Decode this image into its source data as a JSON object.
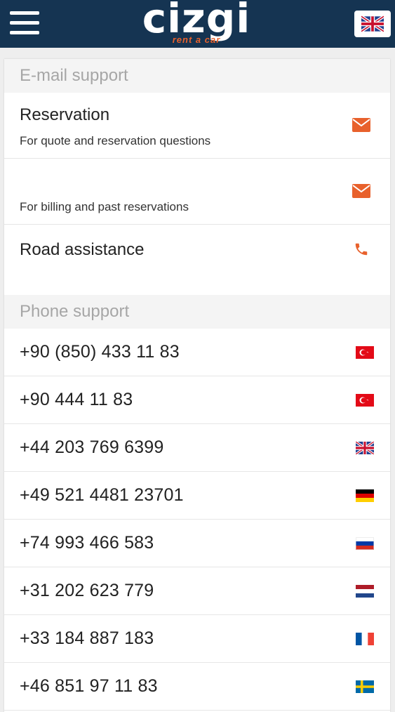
{
  "header": {
    "logo_main": "cizgi",
    "logo_sub": "rent a car",
    "language_flag_icon": "uk-flag-icon",
    "background": "#153452"
  },
  "accent_color": "#e8612c",
  "email_support": {
    "heading": "E-mail support",
    "items": [
      {
        "title": "Reservation",
        "description": "For quote and reservation questions",
        "icon": "envelope-icon"
      },
      {
        "title": "",
        "description": "For billing and past reservations",
        "icon": "envelope-icon"
      }
    ]
  },
  "road_assistance": {
    "title": "Road assistance",
    "icon": "phone-icon"
  },
  "phone_support": {
    "heading": "Phone support",
    "numbers": [
      {
        "number": "+90 (850) 433 11 83",
        "flag": "turkey-flag-icon"
      },
      {
        "number": "+90 444 11 83",
        "flag": "turkey-flag-icon"
      },
      {
        "number": "+44 203 769 6399",
        "flag": "uk-flag-icon"
      },
      {
        "number": "+49 521 4481 23701",
        "flag": "germany-flag-icon"
      },
      {
        "number": "+74 993 466 583",
        "flag": "russia-flag-icon"
      },
      {
        "number": "+31 202 623 779",
        "flag": "netherlands-flag-icon"
      },
      {
        "number": "+33 184 887 183",
        "flag": "france-flag-icon"
      },
      {
        "number": "+46 851 97 11 83",
        "flag": "sweden-flag-icon"
      }
    ]
  }
}
